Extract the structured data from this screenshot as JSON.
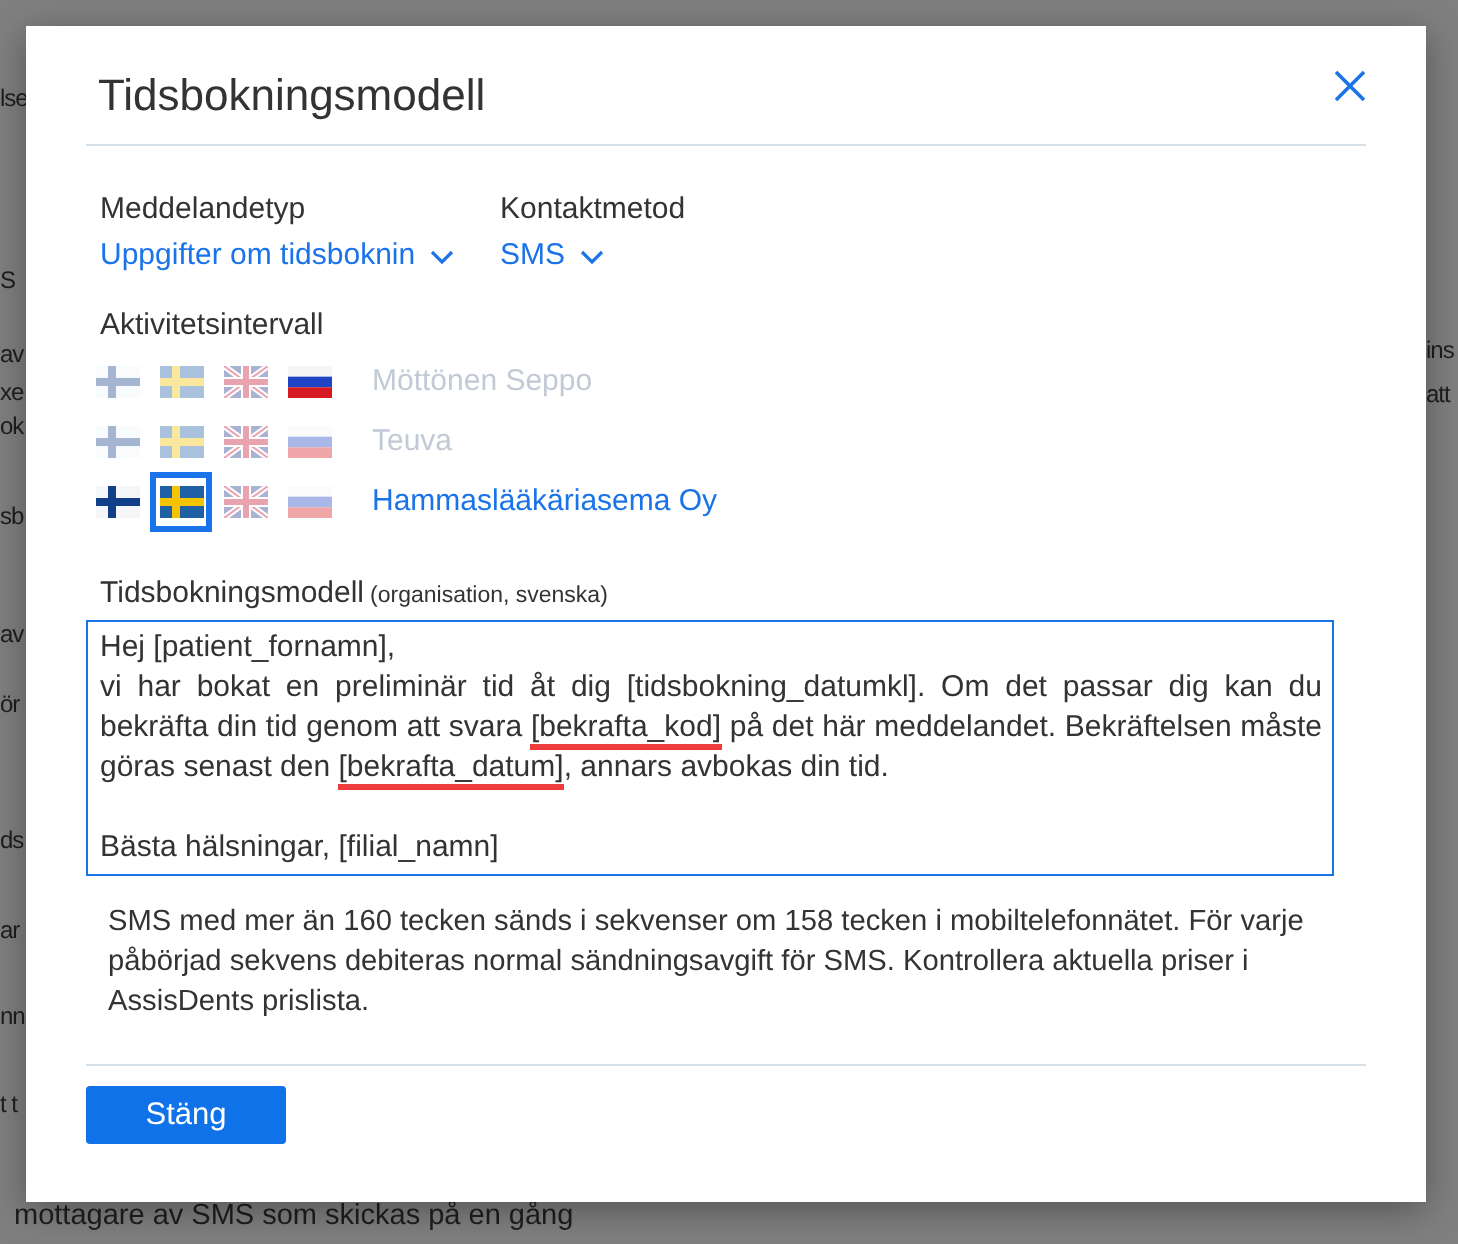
{
  "background": {
    "left_fragments": [
      "lse",
      "S",
      "av",
      "xe",
      "ok",
      "sb",
      "av",
      "ör",
      "ds",
      "ar",
      "nn",
      "t t"
    ],
    "right_fragments": [
      "ins",
      "att"
    ],
    "bottom_text": "mottagare av SMS som skickas på en gång"
  },
  "dialog": {
    "title": "Tidsbokningsmodell",
    "fields": [
      {
        "label": "Meddelandetyp",
        "value": "Uppgifter om tidsboknin"
      },
      {
        "label": "Kontaktmetod",
        "value": "SMS"
      }
    ],
    "activity": {
      "label": "Aktivitetsintervall",
      "organisations": [
        {
          "name": "Möttönen Seppo",
          "selected": false,
          "flags": [
            {
              "kind": "fi",
              "active": false,
              "selected": false
            },
            {
              "kind": "se",
              "active": false,
              "selected": false
            },
            {
              "kind": "uk",
              "active": false,
              "selected": false
            },
            {
              "kind": "ru",
              "active": true,
              "selected": false
            }
          ]
        },
        {
          "name": "Teuva",
          "selected": false,
          "flags": [
            {
              "kind": "fi",
              "active": false,
              "selected": false
            },
            {
              "kind": "se",
              "active": false,
              "selected": false
            },
            {
              "kind": "uk",
              "active": false,
              "selected": false
            },
            {
              "kind": "ru",
              "active": false,
              "selected": false
            }
          ]
        },
        {
          "name": "Hammaslääkäriasema Oy",
          "selected": true,
          "flags": [
            {
              "kind": "fi",
              "active": true,
              "selected": false
            },
            {
              "kind": "se",
              "active": true,
              "selected": true
            },
            {
              "kind": "uk",
              "active": false,
              "selected": false
            },
            {
              "kind": "ru",
              "active": false,
              "selected": false
            }
          ]
        }
      ]
    },
    "template": {
      "label": "Tidsbokningsmodell",
      "note": "(organisation, svenska)",
      "segments": [
        {
          "text": "Hej [patient_fornamn],\nvi har bokat en preliminär tid åt dig [tidsbokning_datumkl]. Om det passar dig kan du bekräfta din tid genom att svara ",
          "flagged": false
        },
        {
          "text": "[bekrafta_kod]",
          "flagged": true
        },
        {
          "text": " på det här meddelandet. Bekräftelsen måste göras senast den ",
          "flagged": false
        },
        {
          "text": "[bekrafta_datum]",
          "flagged": true
        },
        {
          "text": ", annars avbokas din tid.\n\nBästa hälsningar, [filial_namn]",
          "flagged": false
        }
      ]
    },
    "info": "SMS med mer än 160 tecken sänds i sekvenser om 158 tecken i mobiltelefonnätet. För varje påbörjad sekvens debiteras normal sändningsavgift för SMS. Kontrollera aktuella priser i AssisDents prislista.",
    "buttons": [
      {
        "label": "Stäng",
        "kind": "primary"
      }
    ]
  }
}
